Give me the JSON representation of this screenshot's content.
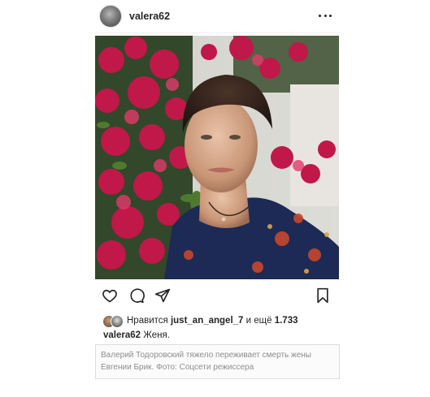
{
  "post": {
    "username": "valera62",
    "avatar_icon": "profile-photo",
    "more_icon": "more-dots-icon"
  },
  "actions": {
    "like_icon": "heart-icon",
    "comment_icon": "comment-icon",
    "share_icon": "send-icon",
    "save_icon": "bookmark-icon"
  },
  "likes": {
    "prefix": "Нравится",
    "user": "just_an_angel_7",
    "middle": "и ещё",
    "count": "1.733"
  },
  "caption": {
    "username": "valera62",
    "text": "Женя."
  },
  "note": {
    "line1": "Валерий Тодоровский тяжело переживает смерть жены",
    "line2": "Евгении Брик. Фото: Соцсети режиссера"
  },
  "colors": {
    "text": "#262626",
    "muted": "#8e8e8e",
    "flowers": "#c01848",
    "dress": "#1c2a55"
  }
}
